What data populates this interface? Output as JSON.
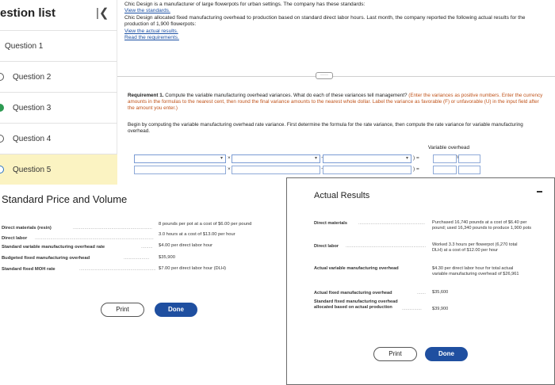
{
  "sidebar": {
    "title": "estion list",
    "collapse_icon": "collapse-left-icon",
    "items": [
      {
        "label": "Question 1"
      },
      {
        "label": "Question 2"
      },
      {
        "label": "Question 3"
      },
      {
        "label": "Question 4"
      },
      {
        "label": "Question 5"
      }
    ]
  },
  "problem": {
    "intro": "Chic Design is a manufacturer of large flowerpots for urban settings. The company has these standards:",
    "link_standards": "View the standards.",
    "body": "Chic Design allocated fixed manufacturing overhead to production based on standard direct labor hours. Last month, the company reported the following actual results for the production of 1,900 flowerpots:",
    "link_actual": "View the actual results.",
    "link_requirements": "Read the requirements."
  },
  "divider_button": "·····",
  "requirement": {
    "lead": "Requirement 1.",
    "text": " Compute the variable manufacturing overhead variances. What do each of these variances tell management? ",
    "instructions": "(Enter the variances as positive numbers. Enter the currency amounts in the formulas to the nearest cent, then round the final variance amounts to the nearest whole dollar. Label the variance as favorable (F) or unfavorable (U) in the input field after the amount you enter.)"
  },
  "begin_text": "Begin by computing the variable manufacturing overhead rate variance. First determine the formula for the rate variance, then compute the rate variance for variable manufacturing overhead.",
  "formula": {
    "header_line1": "Variable overhead",
    "header_line2": "rate variance",
    "op_times": "× (",
    "op_minus": "−",
    "op_close_eq": ") =",
    "op_close_eq2": ") ="
  },
  "standard": {
    "title": "Standard Price and Volume",
    "rows": [
      {
        "label": "Direct materials (resin)",
        "value": "8 pounds per pot at a cost of $6.00 per pound"
      },
      {
        "label": "Direct labor",
        "value": "3.0 hours at a cost of $13.00 per hour"
      },
      {
        "label": "Standard variable manufacturing overhead rate",
        "value": "$4.00 per direct labor hour"
      },
      {
        "label": "Budgeted fixed manufacturing overhead",
        "value": "$35,900"
      },
      {
        "label": "Standard fixed MOH rate",
        "value": "$7.00 per direct labor hour (DLH)"
      }
    ],
    "print_label": "Print",
    "done_label": "Done"
  },
  "actual": {
    "title": "Actual Results",
    "rows": [
      {
        "label": "Direct materials",
        "value": "Purchased 16,740 pounds at a cost of $6.40 per pound; used 16,340 pounds to produce 1,900 pots"
      },
      {
        "label": "Direct labor",
        "value": "Worked 3.3 hours per flowerpot (6,270 total DLH) at a cost of $12.00 per hour"
      },
      {
        "label": "Actual variable manufacturing overhead",
        "value": "$4.30 per direct labor hour for total actual variable manufacturing overhead of $26,961"
      },
      {
        "label": "Actual fixed manufacturing overhead",
        "value": "$35,600"
      },
      {
        "label": "Standard fixed manufacturing overhead allocated based on actual production",
        "value": "$39,900"
      }
    ],
    "print_label": "Print",
    "done_label": "Done"
  }
}
